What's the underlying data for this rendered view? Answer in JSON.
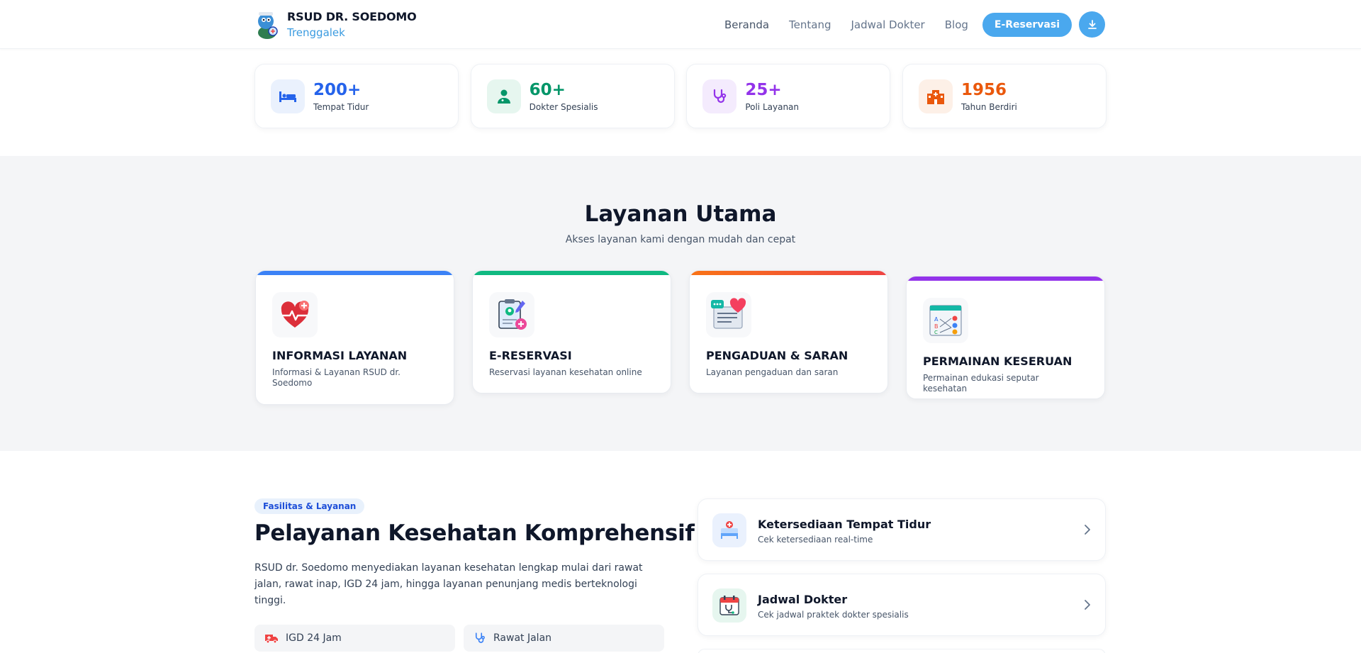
{
  "header": {
    "brand_name": "RSUD DR. SOEDOMO",
    "brand_city": "Trenggalek",
    "nav": [
      "Beranda",
      "Tentang",
      "Jadwal Dokter",
      "Blog"
    ],
    "cta_label": "E-Reservasi",
    "download_icon": "download-icon"
  },
  "stats": [
    {
      "value": "200+",
      "label": "Tempat Tidur",
      "color": "#2563eb",
      "bg": "#eaf1fd",
      "icon": "bed-icon"
    },
    {
      "value": "60+",
      "label": "Dokter Spesialis",
      "color": "#059669",
      "bg": "#e6f6ef",
      "icon": "doctor-icon"
    },
    {
      "value": "25+",
      "label": "Poli Layanan",
      "color": "#9333ea",
      "bg": "#f4ebfd",
      "icon": "stethoscope-icon"
    },
    {
      "value": "1956",
      "label": "Tahun Berdiri",
      "color": "#ea580c",
      "bg": "#fdf0e7",
      "icon": "hospital-building-icon"
    }
  ],
  "layanan": {
    "title": "Layanan Utama",
    "subtitle": "Akses layanan kami dengan mudah dan cepat",
    "cards": [
      {
        "title": "INFORMASI LAYANAN",
        "desc": "Informasi & Layanan RSUD dr. Soedomo",
        "bar": "#3b82f6",
        "icon": "heart-plus-icon"
      },
      {
        "title": "E-RESERVASI",
        "desc": "Reservasi layanan kesehatan online",
        "bar": "#10b981",
        "icon": "clipboard-reservation-icon"
      },
      {
        "title": "PENGADUAN & SARAN",
        "desc": "Layanan pengaduan dan saran",
        "bar": "#f97316",
        "icon": "chat-feedback-icon"
      },
      {
        "title": "PERMAINAN KESERUAN",
        "desc": "Permainan edukasi seputar kesehatan",
        "bar": "#9333ea",
        "icon": "game-board-icon"
      }
    ]
  },
  "fasilitas": {
    "tag": "Fasilitas & Layanan",
    "title": "Pelayanan Kesehatan Komprehensif",
    "paragraph": "RSUD dr. Soedomo menyediakan layanan kesehatan lengkap mulai dari rawat jalan, rawat inap, IGD 24 jam, hingga layanan penunjang medis berteknologi tinggi.",
    "features": [
      {
        "label": "IGD 24 Jam",
        "icon": "ambulance-icon",
        "color": "#ef4444"
      },
      {
        "label": "Rawat Jalan",
        "icon": "stethoscope-icon",
        "color": "#3b82f6"
      }
    ],
    "services": [
      {
        "title": "Ketersediaan Tempat Tidur",
        "desc": "Cek ketersediaan real-time",
        "icon": "bed-availability-icon",
        "bg": "#eaf1fd"
      },
      {
        "title": "Jadwal Dokter",
        "desc": "Cek jadwal praktek dokter spesialis",
        "icon": "calendar-stethoscope-icon",
        "bg": "#e6f6ef"
      }
    ]
  }
}
